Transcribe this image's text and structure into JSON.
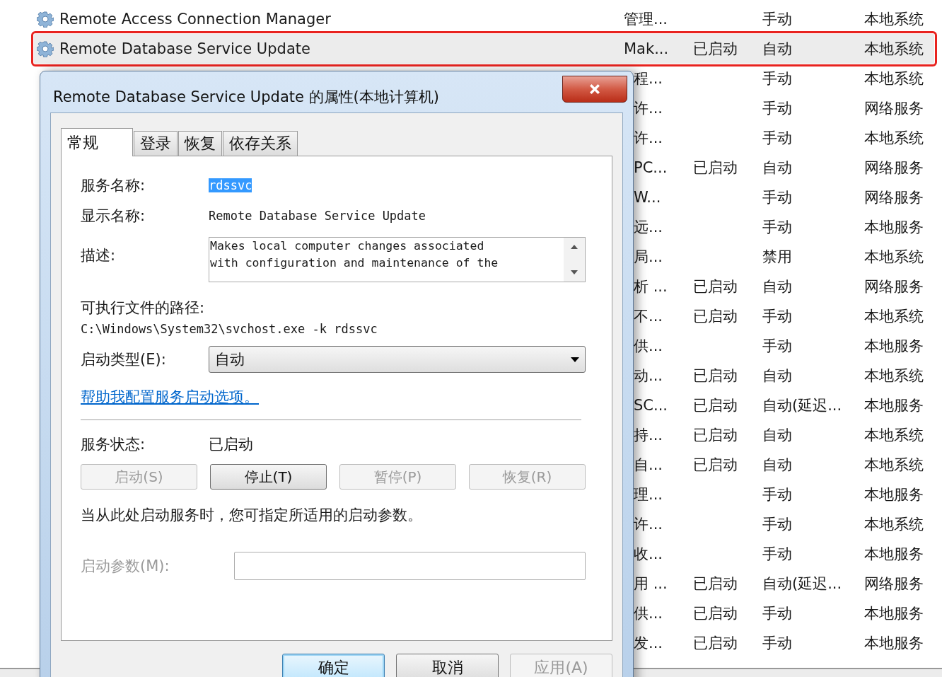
{
  "services": [
    {
      "name": "Remote Access Connection Manager",
      "description": "管理...",
      "startup": "手动",
      "logon": "本地系统",
      "selected": false
    },
    {
      "name": "Remote Database Service Update",
      "description": "Mak...",
      "status": "已启动",
      "startup": "自动",
      "logon": "本地系统",
      "selected": true
    },
    {
      "description": "程...",
      "startup": "手动",
      "logon": "本地系统",
      "selected": false
    },
    {
      "description": "许...",
      "startup": "手动",
      "logon": "网络服务",
      "selected": false
    },
    {
      "description": "许...",
      "startup": "手动",
      "logon": "本地系统",
      "selected": false
    },
    {
      "description": "PC...",
      "status": "已启动",
      "startup": "自动",
      "logon": "网络服务",
      "selected": false
    },
    {
      "description": "W...",
      "startup": "手动",
      "logon": "网络服务",
      "selected": false
    },
    {
      "description": "远...",
      "startup": "手动",
      "logon": "本地服务",
      "selected": false
    },
    {
      "description": "局...",
      "startup": "禁用",
      "logon": "本地系统",
      "selected": false
    },
    {
      "description": "析 ...",
      "status": "已启动",
      "startup": "自动",
      "logon": "网络服务",
      "selected": false
    },
    {
      "description": "不...",
      "status": "已启动",
      "startup": "手动",
      "logon": "本地系统",
      "selected": false
    },
    {
      "description": "供...",
      "startup": "手动",
      "logon": "本地服务",
      "selected": false
    },
    {
      "description": "动...",
      "status": "已启动",
      "startup": "自动",
      "logon": "本地系统",
      "selected": false
    },
    {
      "description": "SC...",
      "status": "已启动",
      "startup": "自动(延迟...",
      "logon": "本地服务",
      "selected": false
    },
    {
      "description": "持...",
      "status": "已启动",
      "startup": "自动",
      "logon": "本地系统",
      "selected": false
    },
    {
      "description": "自...",
      "status": "已启动",
      "startup": "自动",
      "logon": "本地系统",
      "selected": false
    },
    {
      "description": "理...",
      "startup": "手动",
      "logon": "本地服务",
      "selected": false
    },
    {
      "description": "许...",
      "startup": "手动",
      "logon": "本地系统",
      "selected": false
    },
    {
      "description": "收...",
      "startup": "手动",
      "logon": "本地服务",
      "selected": false
    },
    {
      "description": "用 ...",
      "status": "已启动",
      "startup": "自动(延迟...",
      "logon": "网络服务",
      "selected": false
    },
    {
      "description": "供...",
      "status": "已启动",
      "startup": "手动",
      "logon": "本地服务",
      "selected": false
    },
    {
      "description": "发...",
      "status": "已启动",
      "startup": "手动",
      "logon": "本地服务",
      "selected": false
    }
  ],
  "dialog": {
    "title": "Remote Database Service Update 的属性(本地计算机)",
    "tabs": [
      {
        "label": "常规",
        "selected": true
      },
      {
        "label": "登录",
        "selected": false
      },
      {
        "label": "恢复",
        "selected": false
      },
      {
        "label": "依存关系",
        "selected": false
      }
    ],
    "service_name": {
      "label": "服务名称:",
      "value": "rdssvc",
      "selected": true
    },
    "display_name": {
      "label": "显示名称:",
      "value": "Remote Database Service Update"
    },
    "description": {
      "label": "描述:",
      "value": "Makes local computer changes associated\nwith configuration and maintenance of the"
    },
    "path": {
      "label": "可执行文件的路径:",
      "value": "C:\\Windows\\System32\\svchost.exe -k rdssvc"
    },
    "startup_type": {
      "label": "启动类型(E):",
      "value": "自动"
    },
    "help_link": "帮助我配置服务启动选项。",
    "service_status": {
      "label": "服务状态:",
      "value": "已启动"
    },
    "control_buttons": [
      {
        "label": "启动(S)",
        "disabled": true
      },
      {
        "label": "停止(T)",
        "disabled": false
      },
      {
        "label": "暂停(P)",
        "disabled": true
      },
      {
        "label": "恢复(R)",
        "disabled": true
      }
    ],
    "note": "当从此处启动服务时，您可指定所适用的启动参数。",
    "start_parameters": {
      "label": "启动参数(M):",
      "disabled": true
    },
    "buttons": [
      {
        "label": "确定",
        "kind": "default",
        "disabled": false
      },
      {
        "label": "取消",
        "kind": "normal",
        "disabled": false
      },
      {
        "label": "应用(A)",
        "kind": "normal",
        "disabled": true
      }
    ]
  }
}
